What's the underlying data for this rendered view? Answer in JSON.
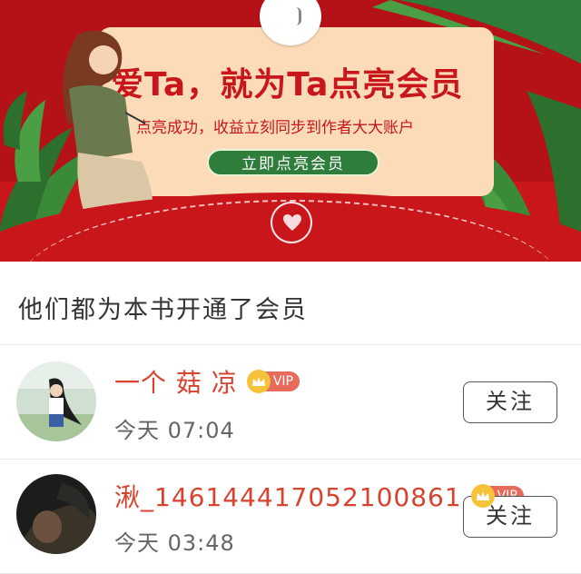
{
  "banner": {
    "title": "爱Ta，就为Ta点亮会员",
    "subtitle": "点亮成功，收益立刻同步到作者大大账户",
    "cta_label": "立即点亮会员",
    "colors": {
      "red": "#c8161b",
      "cream": "#fcdcb8",
      "green": "#2f7d3b"
    }
  },
  "section": {
    "title": "他们都为本书开通了会员"
  },
  "members": [
    {
      "name": "一个 菇 凉",
      "vip_label": "VIP",
      "time": "今天 07:04",
      "follow_label": "关注"
    },
    {
      "name": "湫_1461444170521008​61",
      "vip_label": "VIP",
      "time": "今天 03:48",
      "follow_label": "关注"
    }
  ]
}
